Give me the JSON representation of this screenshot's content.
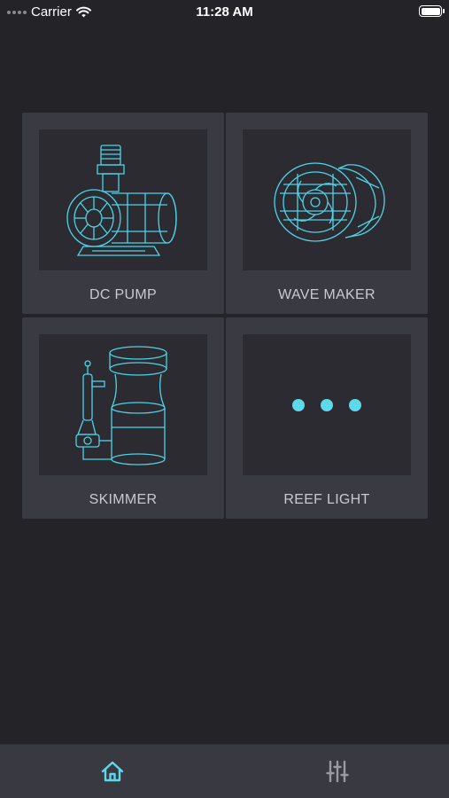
{
  "status_bar": {
    "carrier": "Carrier",
    "time": "11:28 AM"
  },
  "devices": [
    {
      "label": "DC PUMP",
      "icon": "dc-pump-icon"
    },
    {
      "label": "WAVE MAKER",
      "icon": "wave-maker-icon"
    },
    {
      "label": "SKIMMER",
      "icon": "skimmer-icon"
    },
    {
      "label": "REEF LIGHT",
      "icon": "more-dots-icon"
    }
  ],
  "tab_bar": {
    "active_tab": "home",
    "tabs": [
      {
        "icon": "home-icon"
      },
      {
        "icon": "sliders-icon"
      }
    ]
  },
  "colors": {
    "background": "#232328",
    "card": "#3a3a42",
    "art_bg": "#2b2b31",
    "accent": "#5ed9ec",
    "inactive_icon": "#9a9aa0"
  }
}
